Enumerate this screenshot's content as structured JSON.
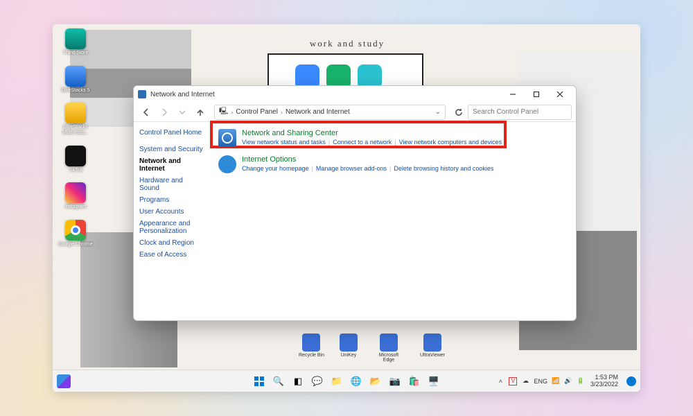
{
  "wallpaper_title": "work and study",
  "desktop_icons": [
    {
      "name": "trans-store",
      "label": "Trans Store",
      "color": "c-teal"
    },
    {
      "name": "bluestacks",
      "label": "BlueStacks 5",
      "color": "c-blue"
    },
    {
      "name": "bluestacks-multi",
      "label": "BlueStacks Multi-Insta...",
      "color": "c-yel"
    },
    {
      "name": "tiktok",
      "label": "TikTok",
      "color": "c-blk"
    },
    {
      "name": "instagram",
      "label": "Instagram",
      "color": "c-ig"
    },
    {
      "name": "chrome",
      "label": "Google Chrome",
      "color": "c-chr"
    }
  ],
  "desktop_shortcuts": [
    {
      "label": "Recycle Bin"
    },
    {
      "label": "UniKey"
    },
    {
      "label": "Microsoft Edge"
    },
    {
      "label": "UltraViewer"
    }
  ],
  "window": {
    "title": "Network and Internet",
    "breadcrumb": {
      "root": "Control Panel",
      "current": "Network and Internet"
    },
    "search_placeholder": "Search Control Panel",
    "sidebar": {
      "home": "Control Panel Home",
      "items": [
        {
          "label": "System and Security"
        },
        {
          "label": "Network and Internet",
          "active": true
        },
        {
          "label": "Hardware and Sound"
        },
        {
          "label": "Programs"
        },
        {
          "label": "User Accounts"
        },
        {
          "label": "Appearance and Personalization"
        },
        {
          "label": "Clock and Region"
        },
        {
          "label": "Ease of Access"
        }
      ]
    },
    "categories": [
      {
        "title": "Network and Sharing Center",
        "icon": "net",
        "links": [
          "View network status and tasks",
          "Connect to a network",
          "View network computers and devices"
        ]
      },
      {
        "title": "Internet Options",
        "icon": "ie",
        "links": [
          "Change your homepage",
          "Manage browser add-ons",
          "Delete browsing history and cookies"
        ]
      }
    ]
  },
  "taskbar": {
    "lang": "ENG",
    "time": "1:53 PM",
    "date": "3/23/2022"
  }
}
